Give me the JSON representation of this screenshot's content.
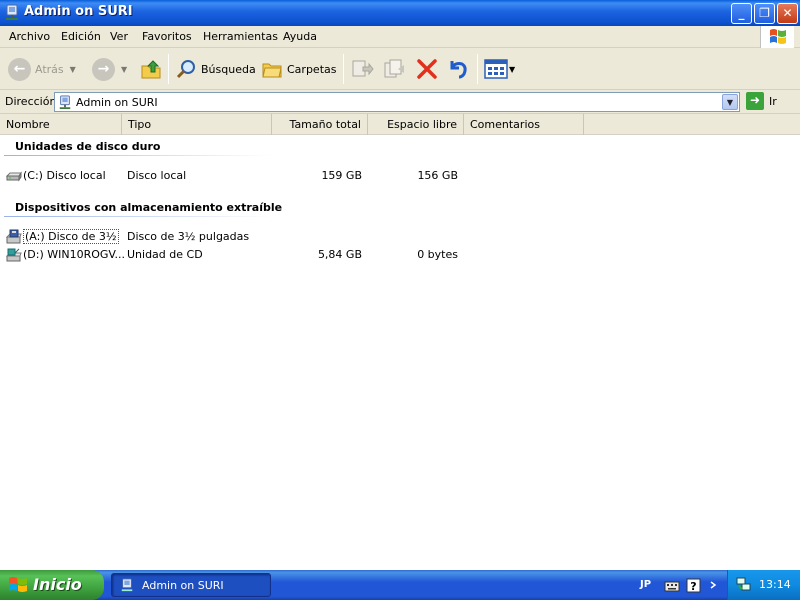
{
  "window": {
    "title": "Admin on SURI"
  },
  "menu": [
    "Archivo",
    "Edición",
    "Ver",
    "Favoritos",
    "Herramientas",
    "Ayuda"
  ],
  "toolbar": {
    "back_label": "Atrás",
    "search_label": "Búsqueda",
    "folders_label": "Carpetas"
  },
  "address": {
    "label": "Dirección",
    "value": "Admin on SURI",
    "go_label": "Ir"
  },
  "columns": [
    "Nombre",
    "Tipo",
    "Tamaño total",
    "Espacio libre",
    "Comentarios"
  ],
  "groups": [
    {
      "title": "Unidades de disco duro",
      "items": [
        {
          "name": "(C:) Disco local",
          "type": "Disco local",
          "total": "159 GB",
          "free": "156 GB",
          "icon": "hard-disk-icon"
        }
      ]
    },
    {
      "title": "Dispositivos con almacenamiento extraíble",
      "items": [
        {
          "name": "(A:) Disco de 3½",
          "type": "Disco de 3½ pulgadas",
          "total": "",
          "free": "",
          "icon": "floppy-drive-icon"
        },
        {
          "name": "(D:) WIN10ROGV...",
          "type": "Unidad de CD",
          "total": "5,84 GB",
          "free": "0 bytes",
          "icon": "cd-drive-icon"
        }
      ]
    }
  ],
  "taskbar": {
    "start_label": "Inicio",
    "task_label": "Admin on SURI",
    "lang": "JP",
    "clock": "13:14"
  },
  "colors": {
    "titlebar": "#0a5fd8",
    "taskbar": "#2157d7",
    "start": "#3c9a3c",
    "chrome": "#ece9d8"
  }
}
